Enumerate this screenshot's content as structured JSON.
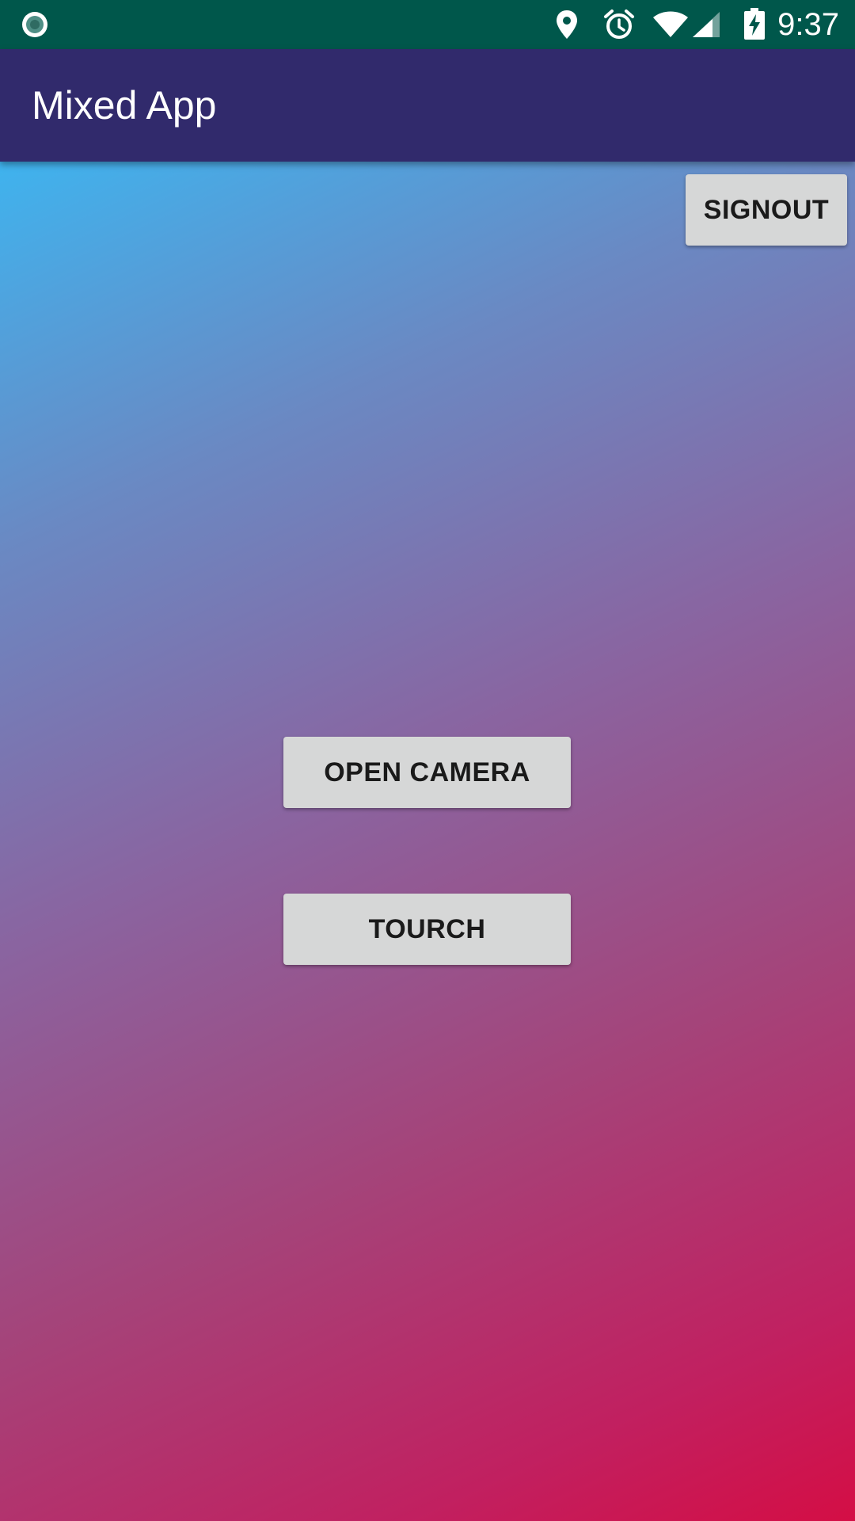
{
  "status_bar": {
    "time": "9:37",
    "left_icon": "sync-circle-icon",
    "icons": [
      "location-pin-icon",
      "alarm-icon",
      "wifi-icon",
      "cell-signal-icon",
      "battery-charging-icon"
    ],
    "background": "#00574b"
  },
  "app_bar": {
    "title": "Mixed App",
    "background": "#312a6c"
  },
  "main": {
    "signout_label": "SIGNOUT",
    "open_camera_label": "OPEN CAMERA",
    "torch_label": "TOURCH",
    "gradient_start": "#3fb3ee",
    "gradient_end": "#d40e45",
    "button_color": "#d6d7d7"
  }
}
